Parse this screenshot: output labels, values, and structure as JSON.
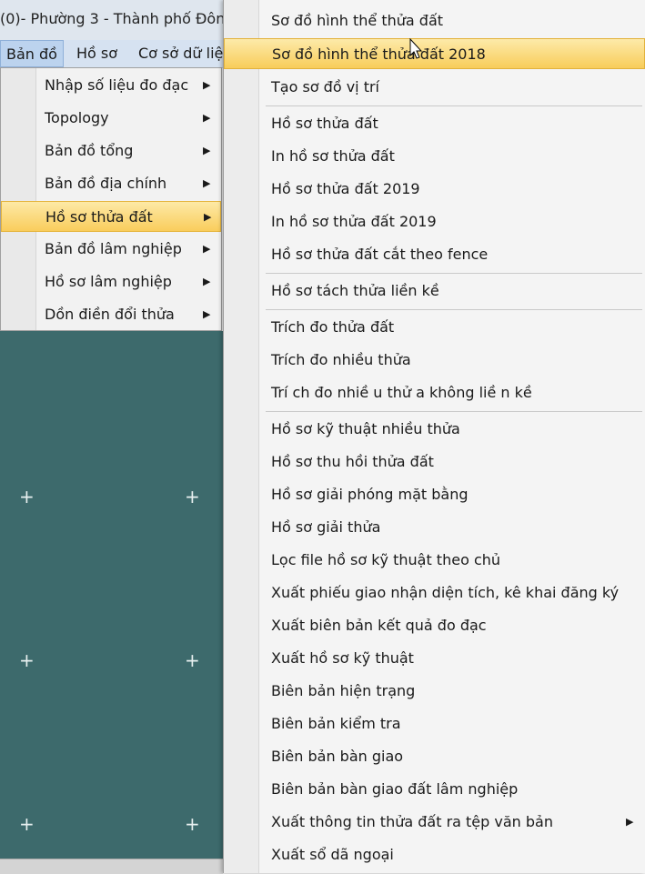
{
  "window": {
    "title": "(0)- Phường 3 - Thành phố Đôn"
  },
  "menubar": {
    "items": [
      {
        "label": "Bản đồ",
        "active": true
      },
      {
        "label": "Hồ sơ"
      },
      {
        "label": "Cơ sở dữ liệ"
      }
    ]
  },
  "submenu_ban_do": {
    "items": [
      {
        "label": "Nhập số liệu đo đạc",
        "has_submenu": true
      },
      {
        "label": "Topology",
        "has_submenu": true
      },
      {
        "label": "Bản đồ tổng",
        "has_submenu": true
      },
      {
        "label": "Bản đồ địa chính",
        "has_submenu": true
      },
      {
        "label": "Hồ sơ thửa đất",
        "has_submenu": true,
        "highlighted": true
      },
      {
        "label": "Bản đồ lâm nghiệp",
        "has_submenu": true
      },
      {
        "label": "Hồ sơ lâm nghiệp",
        "has_submenu": true
      },
      {
        "label": "Dồn điền đổi thửa",
        "has_submenu": true
      }
    ]
  },
  "submenu_ho_so_thua_dat": {
    "items": [
      {
        "label": "Sơ đồ hình thể thửa đất"
      },
      {
        "label": "Sơ đồ hình thể thửa đất 2018",
        "highlighted": true
      },
      {
        "label": "Tạo sơ đồ vị trí"
      },
      {
        "label": "Hồ sơ thửa đất"
      },
      {
        "label": "In hồ sơ thửa đất"
      },
      {
        "label": "Hồ sơ thửa đất 2019"
      },
      {
        "label": "In hồ sơ thửa đất 2019"
      },
      {
        "label": "Hồ sơ thửa đất cắt theo fence"
      },
      {
        "label": "Hồ sơ tách thửa liền kề"
      },
      {
        "label": "Trích đo thửa đất"
      },
      {
        "label": "Trích đo nhiều thửa"
      },
      {
        "label": "Trí ch đo nhiề u thử a không liề n kề"
      },
      {
        "label": "Hồ sơ kỹ thuật nhiều thửa"
      },
      {
        "label": "Hồ sơ thu hồi thửa đất"
      },
      {
        "label": "Hồ sơ giải phóng mặt bằng"
      },
      {
        "label": "Hồ sơ giải thửa"
      },
      {
        "label": "Lọc file hồ sơ kỹ thuật theo chủ"
      },
      {
        "label": "Xuất phiếu giao nhận diện tích, kê khai đăng ký"
      },
      {
        "label": "Xuất biên bản kết quả đo đạc"
      },
      {
        "label": "Xuất hồ sơ kỹ thuật"
      },
      {
        "label": "Biên bản hiện trạng"
      },
      {
        "label": "Biên bản kiểm tra"
      },
      {
        "label": "Biên bản bàn giao"
      },
      {
        "label": "Biên bản bàn giao đất lâm nghiệp"
      },
      {
        "label": "Xuất thông tin thửa đất ra tệp văn bản",
        "has_submenu": true
      },
      {
        "label": "Xuất sổ dã ngoại"
      }
    ]
  },
  "icons": {
    "submenu_arrow": "triangle-right-icon",
    "canvas_marker": "plus-icon",
    "pointer": "mouse-cursor-icon"
  },
  "colors": {
    "highlight": "#f9cd5c",
    "canvas": "#3d6a6c",
    "menubar": "#d6e2f1"
  }
}
